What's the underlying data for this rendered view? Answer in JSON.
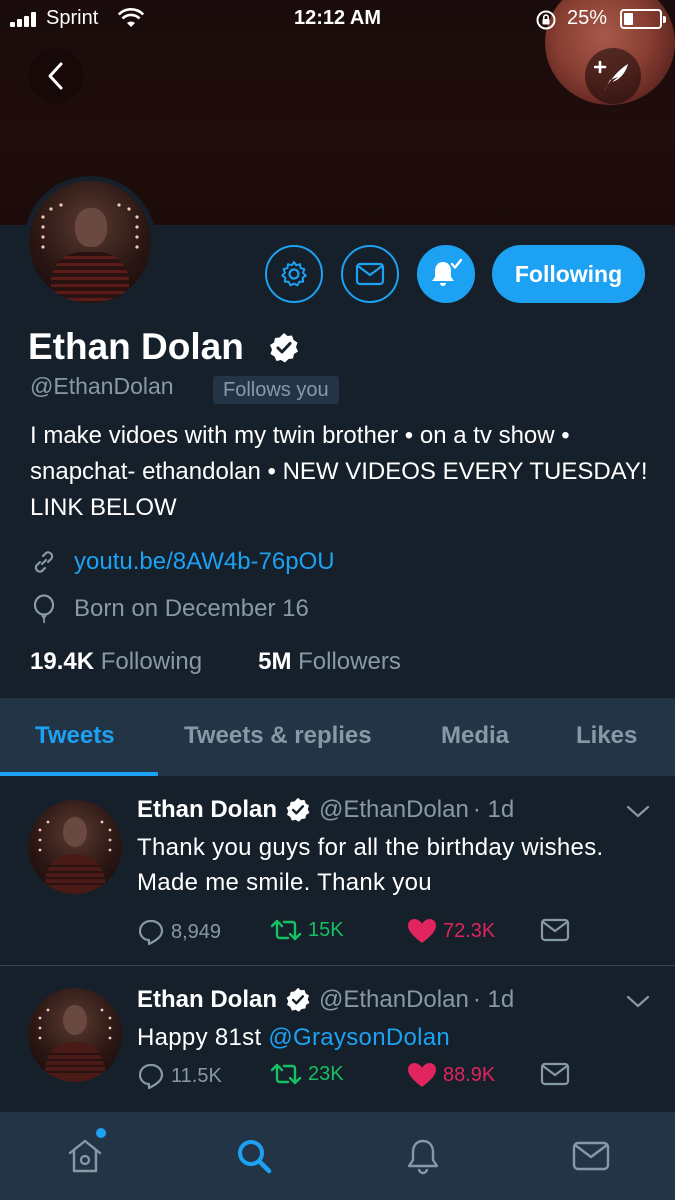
{
  "status_bar": {
    "carrier": "Sprint",
    "time": "12:12 AM",
    "battery_percent": "25%",
    "battery_level": 0.25
  },
  "header": {
    "back_icon": "chevron-left-icon",
    "compose_icon": "compose-tweet-icon"
  },
  "profile": {
    "name": "Ethan Dolan",
    "verified": true,
    "handle": "@EthanDolan",
    "follows_you_label": "Follows you",
    "bio": "I make vidoes with my twin brother • on a tv show • snapchat- ethandolan • NEW VIDEOS EVERY TUESDAY! LINK BELOW",
    "link": "youtu.be/8AW4b-76pOU",
    "birthday": "Born on December 16",
    "following_count": "19.4K",
    "following_label": "Following",
    "followers_count": "5M",
    "followers_label": "Followers",
    "follow_button_label": "Following",
    "notifications_on": true
  },
  "tabs": [
    {
      "label": "Tweets",
      "active": true
    },
    {
      "label": "Tweets & replies",
      "active": false
    },
    {
      "label": "Media",
      "active": false
    },
    {
      "label": "Likes",
      "active": false
    }
  ],
  "tweets": [
    {
      "name": "Ethan Dolan",
      "handle": "@EthanDolan",
      "time": "· 1d",
      "text": "Thank you guys for all the birthday wishes. Made me smile. Thank you",
      "replies": "8,949",
      "retweets": "15K",
      "likes": "72.3K"
    },
    {
      "name": "Ethan Dolan",
      "handle": "@EthanDolan",
      "time": "· 1d",
      "text_prefix": "Happy 81st ",
      "mention": "@GraysonDolan",
      "replies": "11.5K",
      "retweets": "23K",
      "likes": "88.9K"
    }
  ],
  "colors": {
    "background": "#15202b",
    "surface": "#243447",
    "accent": "#1da1f2",
    "secondary_text": "#8899a6",
    "retweet_green": "#17bf63",
    "like_red": "#e0245e"
  },
  "bottom_nav": [
    {
      "icon": "home-icon",
      "active": false,
      "has_dot": true
    },
    {
      "icon": "search-icon",
      "active": true
    },
    {
      "icon": "bell-icon",
      "active": false
    },
    {
      "icon": "mail-icon",
      "active": false
    }
  ]
}
